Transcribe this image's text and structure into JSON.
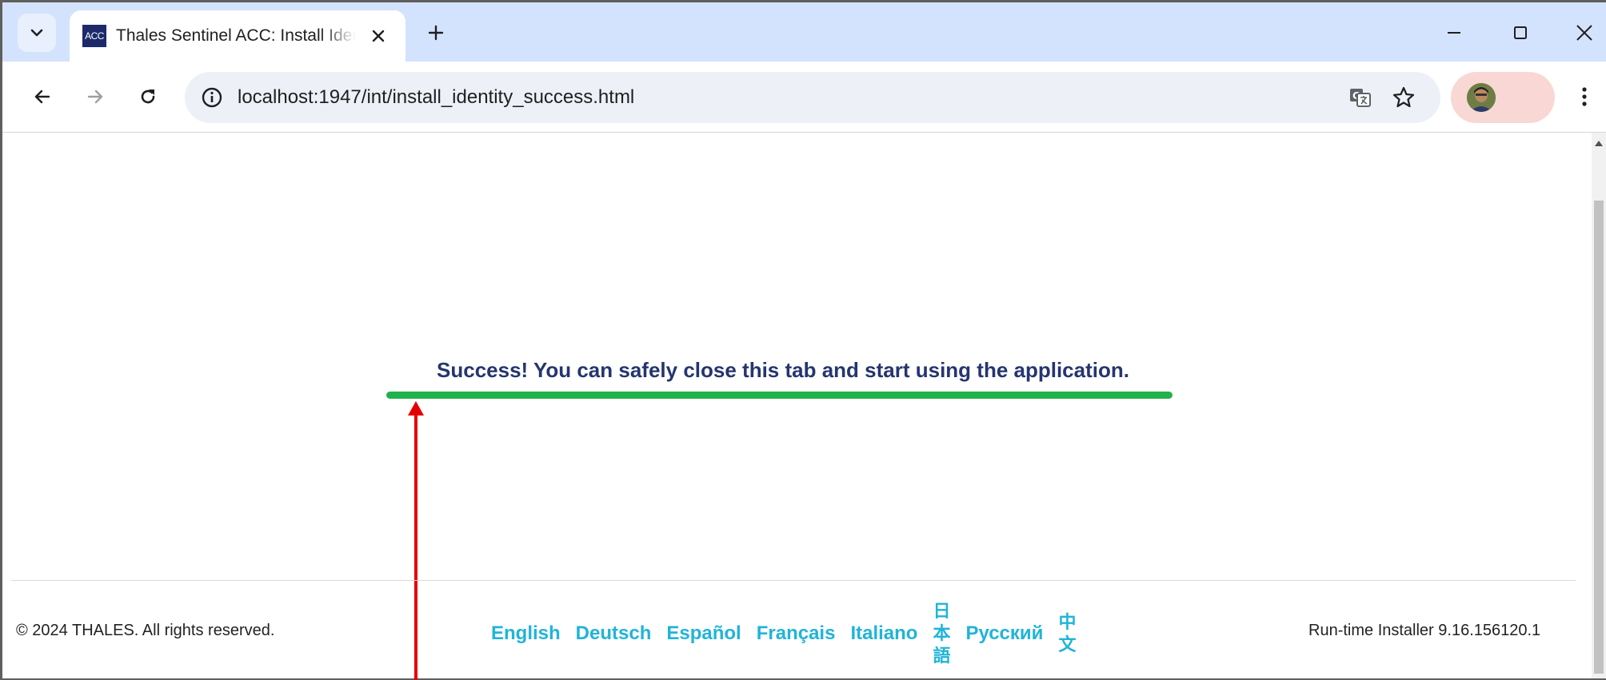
{
  "browser": {
    "tab": {
      "favicon_text": "ACC",
      "title": "Thales Sentinel ACC: Install Identity"
    },
    "address_bar": {
      "url": "localhost:1947/int/install_identity_success.html"
    },
    "icons": {
      "tab_search": "chevron-down-icon",
      "tab_close": "close-icon",
      "new_tab": "plus-icon",
      "minimize": "minimize-icon",
      "maximize": "maximize-icon",
      "close_window": "close-icon",
      "back": "arrow-left-icon",
      "forward": "arrow-right-icon",
      "reload": "reload-icon",
      "site_info": "info-icon",
      "translate": "translate-icon",
      "bookmark": "star-icon",
      "menu": "kebab-menu-icon"
    },
    "colors": {
      "tabstrip": "#d3e3fd",
      "omnibox": "#edf0f7",
      "profile": "#f9d7d4"
    }
  },
  "page": {
    "success_message": "Success! You can safely close this tab and start using the application.",
    "footer": {
      "copyright": "© 2024 THALES. All rights reserved.",
      "languages": [
        {
          "label": "English",
          "vertical": false
        },
        {
          "label": "Deutsch",
          "vertical": false
        },
        {
          "label": "Español",
          "vertical": false
        },
        {
          "label": "Français",
          "vertical": false
        },
        {
          "label": "Italiano",
          "vertical": false
        },
        {
          "label": "日本語",
          "vertical": true
        },
        {
          "label": "Русский",
          "vertical": false
        },
        {
          "label": "中文",
          "vertical": true
        }
      ],
      "version": "Run-time Installer 9.16.156120.1"
    },
    "colors": {
      "message_text": "#253570",
      "success_bar": "#22b24c",
      "language_link": "#20b4d8",
      "annotation_arrow": "#e50000"
    }
  }
}
